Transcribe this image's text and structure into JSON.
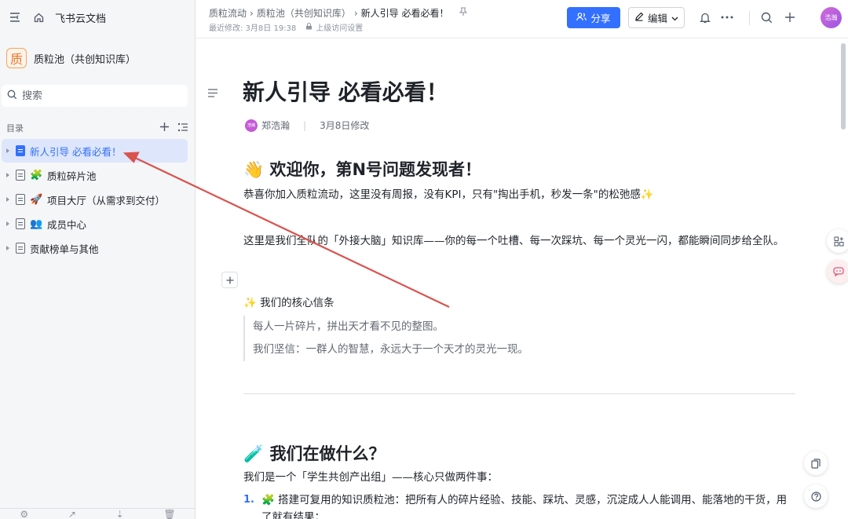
{
  "sidebar": {
    "home_label": "飞书云文档",
    "space_logo": "质",
    "space_name": "质粒池（共创知识库）",
    "search_placeholder": "搜索",
    "toc_label": "目录",
    "tree": [
      {
        "label": "新人引导 必看必看！",
        "icon": "doc-icon",
        "active": true
      },
      {
        "label": "质粒碎片池",
        "emoji": "🧩"
      },
      {
        "label": "项目大厅（从需求到交付）",
        "emoji": "🚀"
      },
      {
        "label": "成员中心",
        "emoji": "👥"
      },
      {
        "label": "贡献榜单与其他",
        "icon": "doc-icon"
      }
    ]
  },
  "header": {
    "crumb_1": "质粒流动",
    "crumb_2": "质粒池（共创知识库）",
    "crumb_3": "新人引导 必看必看！",
    "last_modified": "最近修改: 3月8日 19:38",
    "parent_access": "上级访问设置",
    "share_label": "分享",
    "edit_label": "编辑",
    "avatar_text": "浩瀚"
  },
  "doc": {
    "title": "新人引导 必看必看！",
    "author": "郑浩瀚",
    "author_avatar": "浩瀚",
    "modified": "3月8日修改",
    "h1_welcome": "👋 欢迎你，第N号问题发现者！",
    "p_welcome": "恭喜你加入质粒流动，这里没有周报，没有KPI，只有\"掏出手机，秒发一条\"的松弛感✨",
    "p_brain": "这里是我们全队的「外接大脑」知识库——你的每一个吐槽、每一次踩坑、每一个灵光一闪，都能瞬间同步给全队。",
    "h3_belief": "✨ 我们的核心信条",
    "quote_1": "每人一片碎片，拼出天才看不见的整图。",
    "quote_2": "我们坚信：一群人的智慧，永远大于一个天才的灵光一现。",
    "h1_doing": "🧪 我们在做什么？",
    "p_doing": "我们是一个「学生共创产出组」——核心只做两件事：",
    "li_1_num": "1.",
    "li_1": "🧩 搭建可复用的知识质粒池：把所有人的碎片经验、技能、踩坑、灵感，沉淀成人人能调用、能落地的干货，用了就有结果；"
  },
  "colors": {
    "accent": "#3370ff",
    "sidebar_bg": "#f5f6f7",
    "arrow": "#d9534f"
  }
}
